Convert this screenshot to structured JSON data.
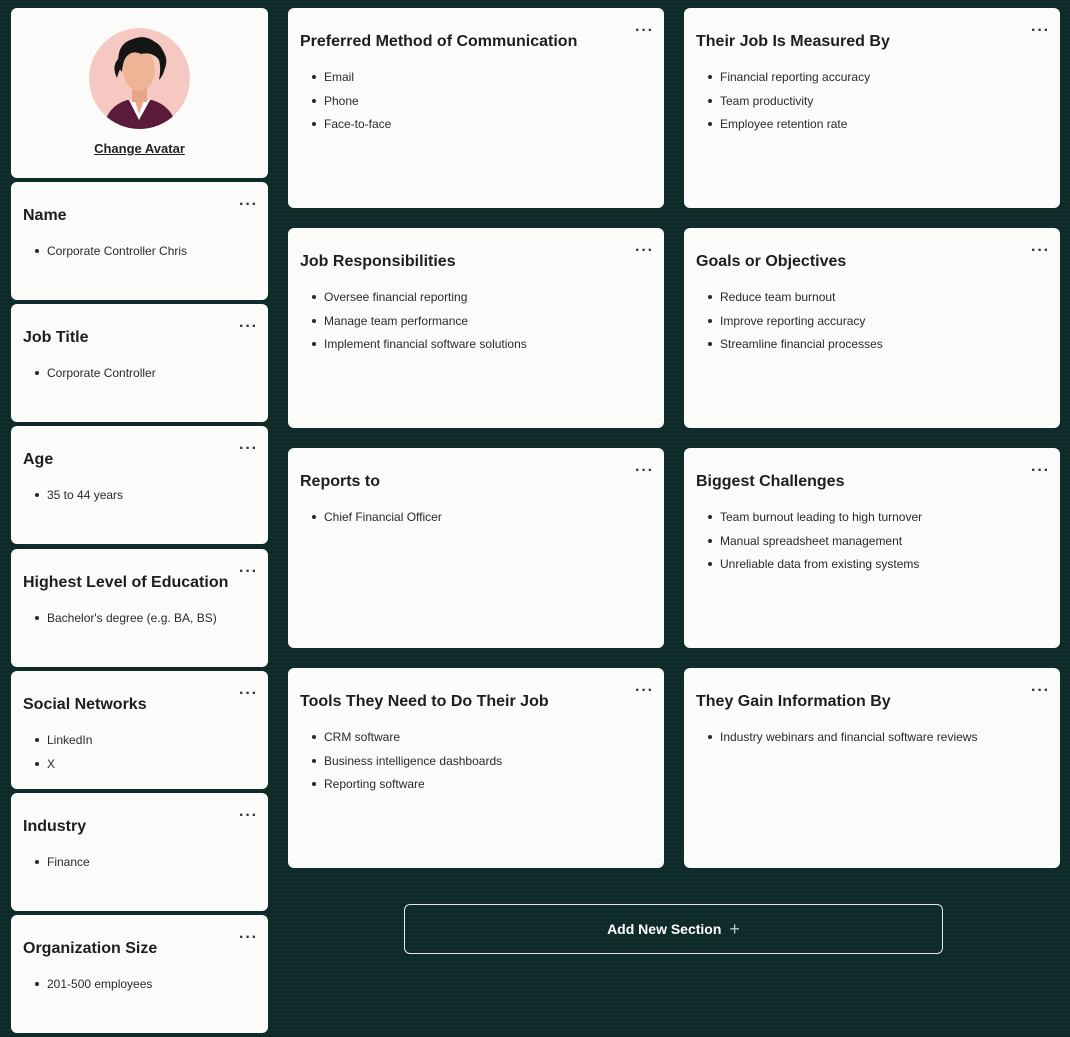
{
  "avatar": {
    "change_label": "Change Avatar"
  },
  "sidebar": [
    {
      "key": "name",
      "title": "Name",
      "items": [
        "Corporate Controller Chris"
      ]
    },
    {
      "key": "job-title",
      "title": "Job Title",
      "items": [
        "Corporate Controller"
      ]
    },
    {
      "key": "age",
      "title": "Age",
      "items": [
        "35 to 44 years"
      ]
    },
    {
      "key": "education",
      "title": "Highest Level of Education",
      "items": [
        "Bachelor's degree (e.g. BA, BS)"
      ]
    },
    {
      "key": "social-networks",
      "title": "Social Networks",
      "items": [
        "LinkedIn",
        "X"
      ]
    },
    {
      "key": "industry",
      "title": "Industry",
      "items": [
        "Finance"
      ]
    },
    {
      "key": "organization-size",
      "title": "Organization Size",
      "items": [
        "201-500 employees"
      ]
    }
  ],
  "main": [
    {
      "key": "communication",
      "title": "Preferred Method of Communication",
      "items": [
        "Email",
        "Phone",
        "Face-to-face"
      ]
    },
    {
      "key": "measured-by",
      "title": "Their Job Is Measured By",
      "items": [
        "Financial reporting accuracy",
        "Team productivity",
        "Employee retention rate"
      ]
    },
    {
      "key": "responsibilities",
      "title": "Job Responsibilities",
      "items": [
        "Oversee financial reporting",
        "Manage team performance",
        "Implement financial software solutions"
      ]
    },
    {
      "key": "goals",
      "title": "Goals or Objectives",
      "items": [
        "Reduce team burnout",
        "Improve reporting accuracy",
        "Streamline financial processes"
      ]
    },
    {
      "key": "reports-to",
      "title": "Reports to",
      "items": [
        "Chief Financial Officer"
      ]
    },
    {
      "key": "challenges",
      "title": "Biggest Challenges",
      "items": [
        "Team burnout leading to high turnover",
        "Manual spreadsheet management",
        "Unreliable data from existing systems"
      ]
    },
    {
      "key": "tools",
      "title": "Tools They Need to Do Their Job",
      "items": [
        "CRM software",
        "Business intelligence dashboards",
        "Reporting software"
      ]
    },
    {
      "key": "information",
      "title": "They Gain Information By",
      "items": [
        "Industry webinars and financial software reviews"
      ]
    }
  ],
  "menu_glyph": "···",
  "add_section": {
    "label": "Add New Section",
    "icon": "plus-icon"
  }
}
